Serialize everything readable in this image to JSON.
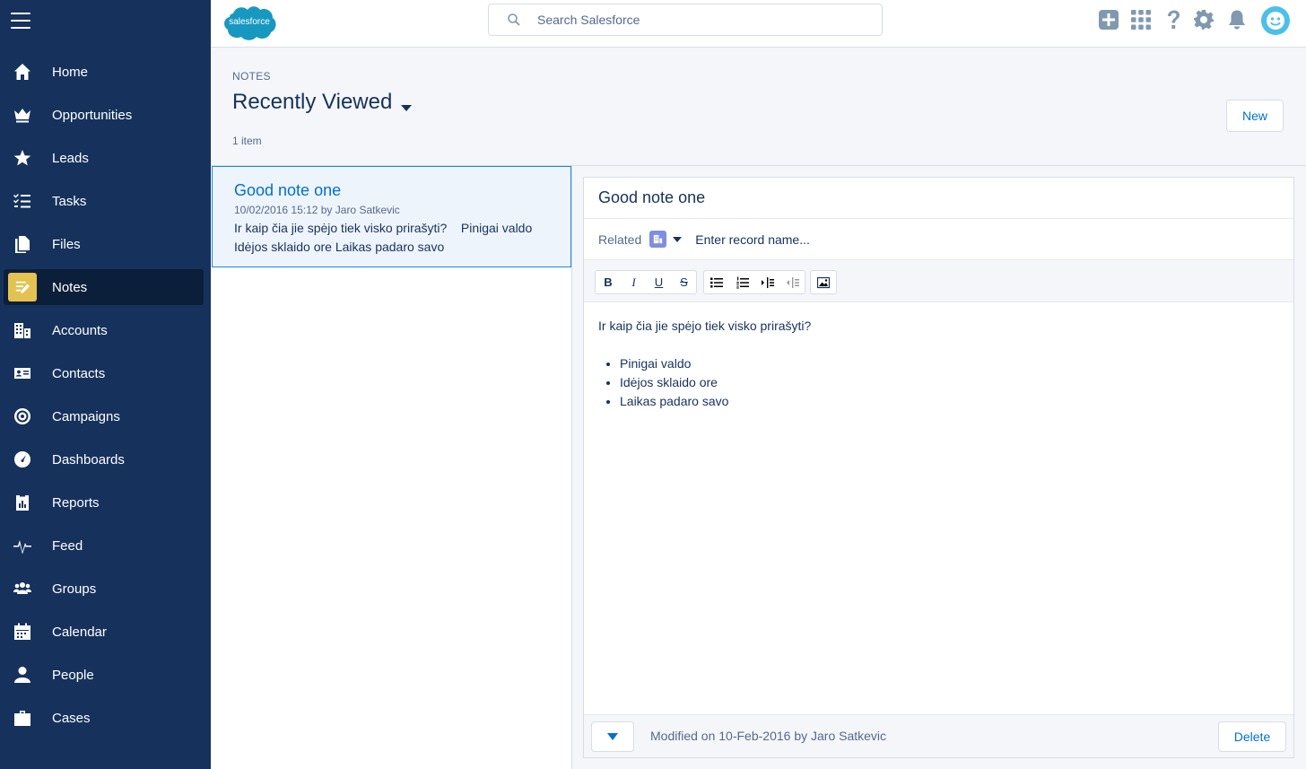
{
  "brand": {
    "logo_text": "salesforce",
    "accent_color": "#0070d2",
    "nav_bg": "#16325c",
    "notes_icon_color": "#e3c252"
  },
  "search": {
    "placeholder": "Search Salesforce"
  },
  "nav": {
    "items": [
      {
        "label": "Home",
        "icon": "home-icon"
      },
      {
        "label": "Opportunities",
        "icon": "crown-icon"
      },
      {
        "label": "Leads",
        "icon": "star-icon"
      },
      {
        "label": "Tasks",
        "icon": "task-list-icon"
      },
      {
        "label": "Files",
        "icon": "files-icon"
      },
      {
        "label": "Notes",
        "icon": "notes-icon",
        "active": true
      },
      {
        "label": "Accounts",
        "icon": "building-icon"
      },
      {
        "label": "Contacts",
        "icon": "contact-card-icon"
      },
      {
        "label": "Campaigns",
        "icon": "target-icon"
      },
      {
        "label": "Dashboards",
        "icon": "gauge-icon"
      },
      {
        "label": "Reports",
        "icon": "report-icon"
      },
      {
        "label": "Feed",
        "icon": "pulse-icon"
      },
      {
        "label": "Groups",
        "icon": "groups-icon"
      },
      {
        "label": "Calendar",
        "icon": "calendar-icon"
      },
      {
        "label": "People",
        "icon": "person-icon"
      },
      {
        "label": "Cases",
        "icon": "briefcase-icon"
      }
    ]
  },
  "list_header": {
    "object_label": "NOTES",
    "title": "Recently Viewed",
    "count": "1 item",
    "new_label": "New"
  },
  "note_list": {
    "items": [
      {
        "title": "Good note one",
        "meta": "10/02/2016 15:12 by Jaro Satkevic",
        "preview": "Ir kaip čia jie spėjo tiek visko prirašyti?    Pinigai valdo Idėjos sklaido ore Laikas padaro savo"
      }
    ]
  },
  "editor": {
    "title": "Good note one",
    "related_label": "Related",
    "related_placeholder": "Enter record name...",
    "toolbar": [
      "bold",
      "italic",
      "underline",
      "strikethrough",
      "bulleted-list",
      "numbered-list",
      "indent",
      "outdent",
      "image"
    ],
    "toolbar_letters": {
      "bold": "B",
      "italic": "I",
      "underline": "U",
      "strikethrough": "S"
    },
    "body": {
      "paragraph": "Ir kaip čia jie spėjo tiek visko prirašyti?",
      "bullets": [
        "Pinigai valdo",
        "Idėjos sklaido ore",
        "Laikas padaro savo"
      ]
    },
    "footer": {
      "modified": "Modified on 10-Feb-2016 by Jaro Satkevic",
      "delete_label": "Delete"
    }
  }
}
